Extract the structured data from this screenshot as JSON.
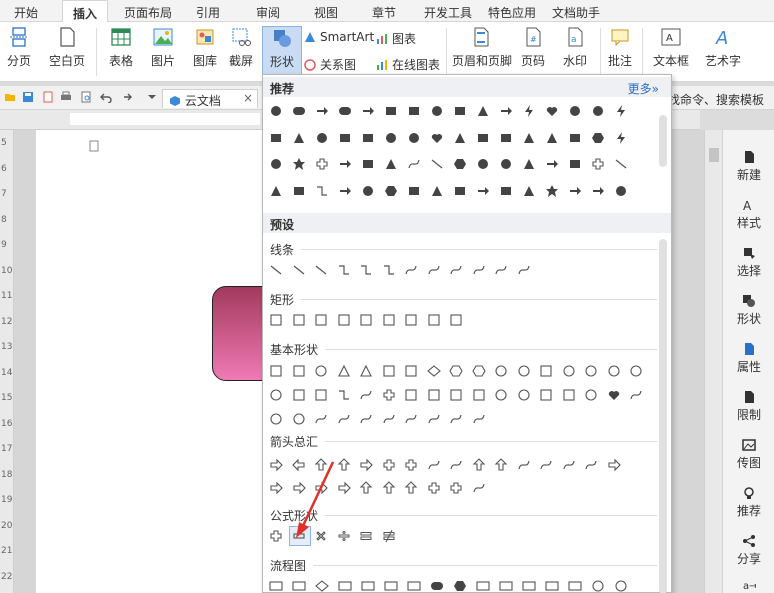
{
  "tabs": [
    "开始",
    "插入",
    "页面布局",
    "引用",
    "审阅",
    "视图",
    "章节",
    "开发工具",
    "特色应用",
    "文档助手"
  ],
  "ribbon": {
    "page_break": "分页",
    "blank_page": "空白页",
    "table": "表格",
    "picture": "图片",
    "gallery": "图库",
    "screenshot": "截屏",
    "shapes": "形状",
    "smartart": "SmartArt",
    "chart": "图表",
    "relation": "关系图",
    "online_chart": "在线图表",
    "header_footer": "页眉和页脚",
    "page_number": "页码",
    "watermark": "水印",
    "comment": "批注",
    "textbox": "文本框",
    "wordart": "艺术字"
  },
  "quickbar": {
    "doc_tab": "云文档",
    "hint": "找命令、搜索模板"
  },
  "dropdown": {
    "recommended": "推荐",
    "more": "更多»",
    "presets": "预设",
    "categories": [
      "线条",
      "矩形",
      "基本形状",
      "箭头总汇",
      "公式形状",
      "流程图"
    ]
  },
  "right_panel": [
    "新建",
    "样式",
    "选择",
    "形状",
    "属性",
    "限制",
    "传图",
    "推荐",
    "分享"
  ],
  "ruler_numbers": [
    "5",
    "6",
    "7",
    "8",
    "9",
    "10",
    "11",
    "12",
    "13",
    "14",
    "15",
    "16",
    "17",
    "18",
    "19",
    "20",
    "21",
    "22"
  ],
  "colors": {
    "accent": "#2a6fc9",
    "selected_bg": "#c9dcf3",
    "shape_gradient_top": "#a23a5c",
    "shape_gradient_bottom": "#f07ab5",
    "annotation_arrow": "#e0302a"
  }
}
